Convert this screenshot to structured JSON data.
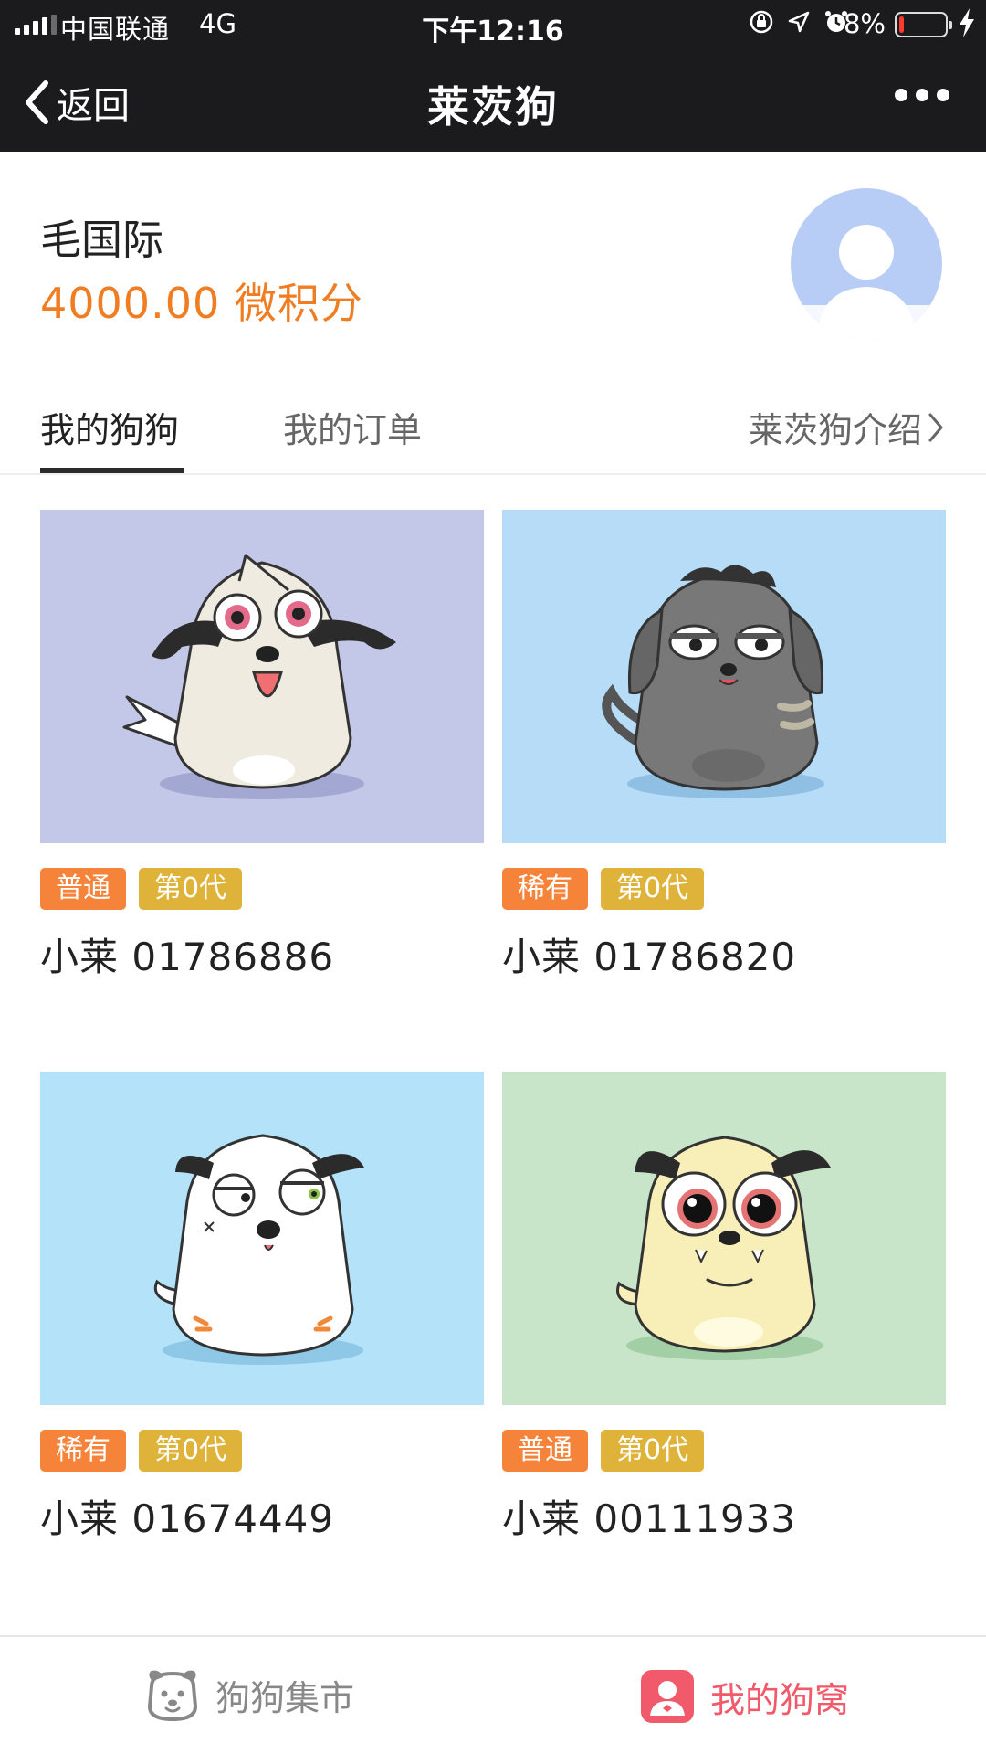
{
  "status_bar": {
    "carrier": "中国联通",
    "network": "4G",
    "time": "下午12:16",
    "battery_percent": "8%",
    "battery_level": 0.08,
    "icons": [
      "orientation-lock-icon",
      "location-icon",
      "alarm-icon",
      "battery-icon",
      "charging-icon"
    ]
  },
  "nav": {
    "back_label": "返回",
    "title": "莱茨狗"
  },
  "profile": {
    "name": "毛国际",
    "points": "4000.00 微积分"
  },
  "tabs": {
    "my_dogs": "我的狗狗",
    "my_orders": "我的订单",
    "intro": "莱茨狗介绍"
  },
  "dogs": [
    {
      "rarity": "普通",
      "generation": "第0代",
      "name": "小莱 01786886",
      "bg_color": "#c3c8e8"
    },
    {
      "rarity": "稀有",
      "generation": "第0代",
      "name": "小莱 01786820",
      "bg_color": "#b7dcf7"
    },
    {
      "rarity": "稀有",
      "generation": "第0代",
      "name": "小莱 01674449",
      "bg_color": "#b3e2f9"
    },
    {
      "rarity": "普通",
      "generation": "第0代",
      "name": "小莱 00111933",
      "bg_color": "#c8e5c9"
    }
  ],
  "bottom_nav": {
    "market": "狗狗集市",
    "my_kennel": "我的狗窝"
  },
  "colors": {
    "accent_orange": "#f07d22",
    "badge_rarity": "#f5833a",
    "badge_generation": "#dfb23a",
    "active_bottom": "#f05a6a",
    "header_bg": "#1b1b1e"
  }
}
